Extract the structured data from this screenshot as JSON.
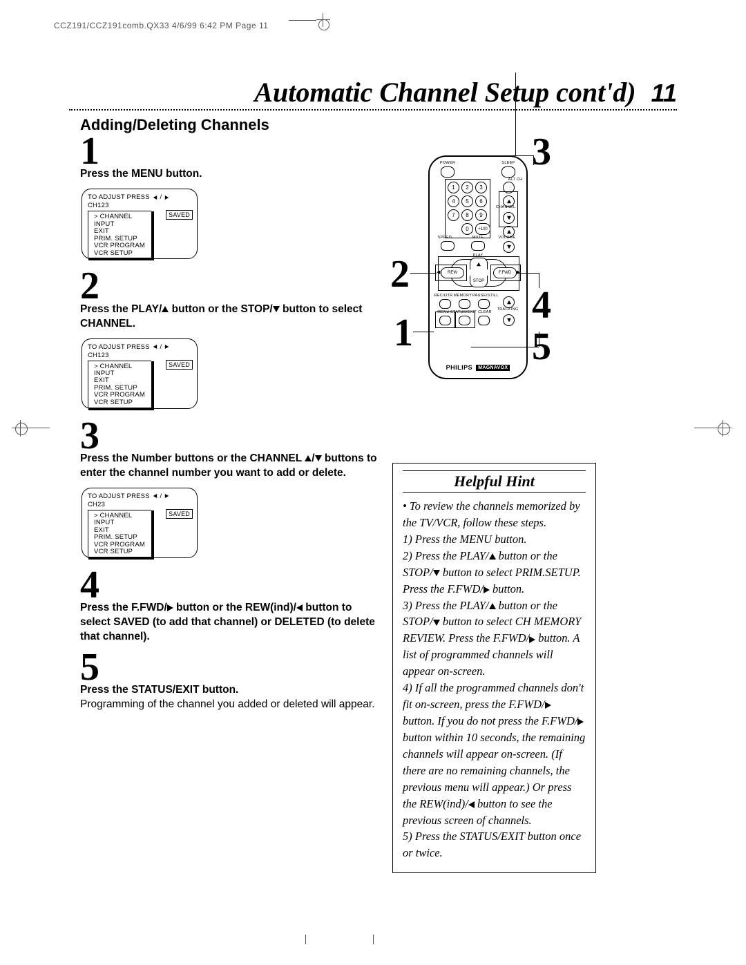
{
  "header": {
    "slug": "CCZ191/CCZ191comb.QX33  4/6/99 6:42 PM  Page 11"
  },
  "title": "Automatic Channel Setup cont'd)",
  "pageNumber": "11",
  "subtitle": "Adding/Deleting Channels",
  "steps": {
    "s1": {
      "num": "1",
      "text": "Press the MENU button."
    },
    "s2": {
      "num": "2",
      "text_a": "Press the PLAY/",
      "text_b": " button or the STOP/",
      "text_c": " button to select CHANNEL."
    },
    "s3": {
      "num": "3",
      "text_a": "Press the Number buttons or the CHANNEL ",
      "text_b": "/",
      "text_c": " buttons to enter the channel number you want to add or delete."
    },
    "s4": {
      "num": "4",
      "text_a": "Press the F.FWD/",
      "text_b": " button or the REW(ind)/",
      "text_c": " button to select SAVED (to add that channel) or DELETED (to delete that channel)."
    },
    "s5": {
      "num": "5",
      "text": "Press the STATUS/EXIT button.",
      "body": "Programming of the channel you added or deleted will appear."
    }
  },
  "osd": {
    "toAdjust": "TO ADJUST PRESS",
    "ch123": "CH123",
    "ch23": "CH23",
    "saved": "SAVED",
    "menu": {
      "channel": "> CHANNEL",
      "input": "INPUT",
      "exit": "EXIT",
      "prim": "PRIM. SETUP",
      "vcrprog": "VCR PROGRAM",
      "vcrsetup": "VCR SETUP"
    }
  },
  "remote": {
    "labels": {
      "power": "POWER",
      "sleep": "SLEEP",
      "altch": "ALT CH",
      "channel": "CHANNEL",
      "speed": "SPEED",
      "mute": "MUTE",
      "volume": "VOLUME",
      "play": "PLAY",
      "rew": "REW",
      "ffwd": "F.FWD",
      "stop": "STOP",
      "recotr": "REC/OTR",
      "memory": "MEMORY",
      "pausestill": "PAUSE/STILL",
      "menu": "MENU",
      "statusexit": "STATUS/EXIT",
      "clear": "CLEAR",
      "trking": "TRACKING"
    },
    "keys": {
      "k1": "1",
      "k2": "2",
      "k3": "3",
      "k4": "4",
      "k5": "5",
      "k6": "6",
      "k7": "7",
      "k8": "8",
      "k9": "9",
      "k0": "0",
      "k100": "+100"
    },
    "brand": "PHILIPS",
    "brand2": "MAGNAVOX"
  },
  "callouts": {
    "c1": "1",
    "c2": "2",
    "c3": "3",
    "c4": "4",
    "c5": "5"
  },
  "hint": {
    "title": "Helpful Hint",
    "l0": "To review the channels memorized by the TV/VCR, follow these steps.",
    "l1": "1) Press the MENU button.",
    "l2a": "2) Press the PLAY/",
    "l2b": " button or the STOP/",
    "l2c": " button to select PRIM.SETUP. Press the F.FWD/",
    "l2d": " button.",
    "l3a": "3) Press the PLAY/",
    "l3b": " button or the STOP/",
    "l3c": " button to select CH MEMORY REVIEW. Press the F.FWD/",
    "l3d": " button. A list of programmed channels will appear on-screen.",
    "l4a": "4) If all the programmed channels don't fit on-screen, press the F.FWD/",
    "l4b": " button. If you do not press the F.FWD/",
    "l4c": " button within 10 seconds, the remaining channels will appear on-screen. (If there are no remaining channels, the previous menu will appear.) Or press the REW(ind)/",
    "l4d": " button to see the previous screen of channels.",
    "l5": "5) Press the STATUS/EXIT button once or twice."
  }
}
